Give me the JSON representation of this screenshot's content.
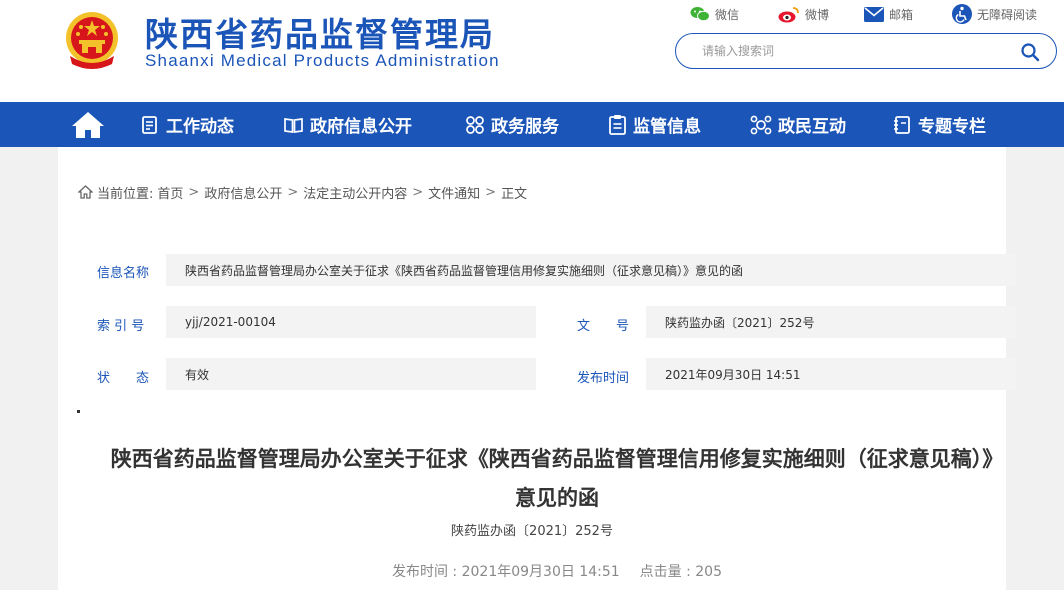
{
  "header": {
    "title_cn": "陕西省药品监督管理局",
    "title_en": "Shaanxi Medical Products Administration",
    "links": {
      "wechat": "微信",
      "weibo": "微博",
      "mail": "邮箱",
      "accessibility": "无障碍阅读"
    },
    "search": {
      "placeholder": "请输入搜索词"
    }
  },
  "nav": {
    "items": [
      {
        "label": "工作动态"
      },
      {
        "label": "政府信息公开"
      },
      {
        "label": "政务服务"
      },
      {
        "label": "监管信息"
      },
      {
        "label": "政民互动"
      },
      {
        "label": "专题专栏"
      }
    ]
  },
  "breadcrumb": {
    "prefix": "当前位置:",
    "items": [
      "首页",
      "政府信息公开",
      "法定主动公开内容",
      "文件通知",
      "正文"
    ]
  },
  "meta": {
    "name_label": "信息名称",
    "name_value": "陕西省药品监督管理局办公室关于征求《陕西省药品监督管理信用修复实施细则（征求意见稿）》意见的函",
    "index_label": "索 引 号",
    "index_value": "yjj/2021-00104",
    "docno_label": "文　　号",
    "docno_value": "陕药监办函〔2021〕252号",
    "status_label": "状　　态",
    "status_value": "有效",
    "pubtime_label": "发布时间",
    "pubtime_value": "2021年09月30日 14:51"
  },
  "document": {
    "title": "陕西省药品监督管理局办公室关于征求《陕西省药品监督管理信用修复实施细则（征求意见稿）》意见的函",
    "number": "陕药监办函〔2021〕252号",
    "pubtime_text": "发布时间 : 2021年09月30日 14:51",
    "views_text": "点击量 : 205"
  },
  "colors": {
    "brand_blue": "#1b55b8",
    "emblem_red": "#d7161b",
    "emblem_gold": "#f3c22b"
  }
}
